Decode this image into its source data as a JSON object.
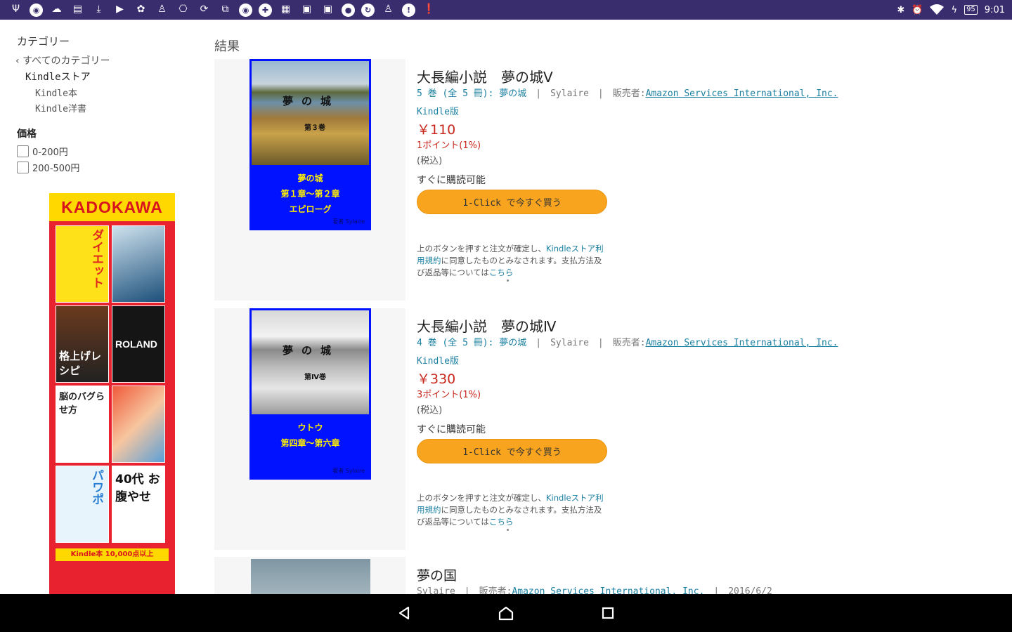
{
  "status_bar": {
    "left_icons": [
      "usb-icon",
      "chrome-icon",
      "cloud-icon",
      "sd-card-icon",
      "download-icon",
      "youtube-icon",
      "bug-icon",
      "android-icon",
      "gamepad-icon",
      "sync-icon",
      "screenshot-icon",
      "chrome-icon",
      "app-icon",
      "keyboard-icon",
      "calendar-icon",
      "calendar-icon",
      "dot-icon",
      "sync-icon",
      "android-icon",
      "info-icon",
      "alert-icon"
    ],
    "bluetooth": "✱",
    "alarm": "⏰",
    "wifi": "wifi-icon",
    "battery": "95",
    "time": "9:01"
  },
  "sidebar": {
    "category_title": "カテゴリー",
    "all_categories": "すべてのカテゴリー",
    "store": "Kindleストア",
    "sub1": "Kindle本",
    "sub2": "Kindle洋書",
    "price_title": "価格",
    "price_options": [
      "0-200円",
      "200-500円"
    ]
  },
  "ad": {
    "brand": "KADOKAWA",
    "books": [
      "ダイエット",
      "",
      "格上げレシピ",
      "ROLAND",
      "脳のバグらせ方",
      "",
      "パワポ",
      "40代 お腹やせ"
    ],
    "footer": "Kindle本 10,000点以上"
  },
  "main": {
    "results_title": "結果",
    "results": [
      {
        "cover_title": "夢の城",
        "cover_sub": "第３巻",
        "cover_lower": [
          "夢の城",
          "第１章〜第２章",
          "エピローグ"
        ],
        "cover_author": "著者 Sylaire",
        "title": "大長編小説　夢の城Ⅴ",
        "series": "5 巻 (全 5 冊): 夢の城",
        "author": "Sylaire",
        "seller_label": "販売者:",
        "seller": "Amazon Services International, Inc.",
        "format": "Kindle版",
        "price": "￥110",
        "points": "1ポイント(1%)",
        "tax": "(税込)",
        "availability": "すぐに購読可能",
        "buy_label": "1-Click で今すぐ買う",
        "note_1": "上のボタンを押すと注文が確定し、",
        "note_link1": "Kindleストア利用規約",
        "note_2": "に同意したものとみなされます。支払方法及び返品等については",
        "note_link2": "こちら"
      },
      {
        "cover_title": "夢の城",
        "cover_sub": "第Ⅳ巻",
        "cover_lower": [
          "ウトウ",
          "第四章〜第六章"
        ],
        "cover_author": "著者 Sylaire",
        "title": "大長編小説　夢の城Ⅳ",
        "series": "4 巻 (全 5 冊): 夢の城",
        "author": "Sylaire",
        "seller_label": "販売者:",
        "seller": "Amazon Services International, Inc.",
        "format": "Kindle版",
        "price": "￥330",
        "points": "3ポイント(1%)",
        "tax": "(税込)",
        "availability": "すぐに購読可能",
        "buy_label": "1-Click で今すぐ買う",
        "note_1": "上のボタンを押すと注文が確定し、",
        "note_link1": "Kindleストア利用規約",
        "note_2": "に同意したものとみなされます。支払方法及び返品等については",
        "note_link2": "こちら"
      }
    ],
    "partial": {
      "title": "夢の国",
      "author": "Sylaire",
      "seller_label": "販売者:",
      "seller": "Amazon Services International, Inc.",
      "date": "2016/6/2"
    }
  },
  "colors": {
    "status_bar": "#3a2d6e",
    "price": "#c8281e",
    "link": "#1a7fa0",
    "buy_button": "#f8a41e",
    "cover_blue": "#0012ff"
  }
}
